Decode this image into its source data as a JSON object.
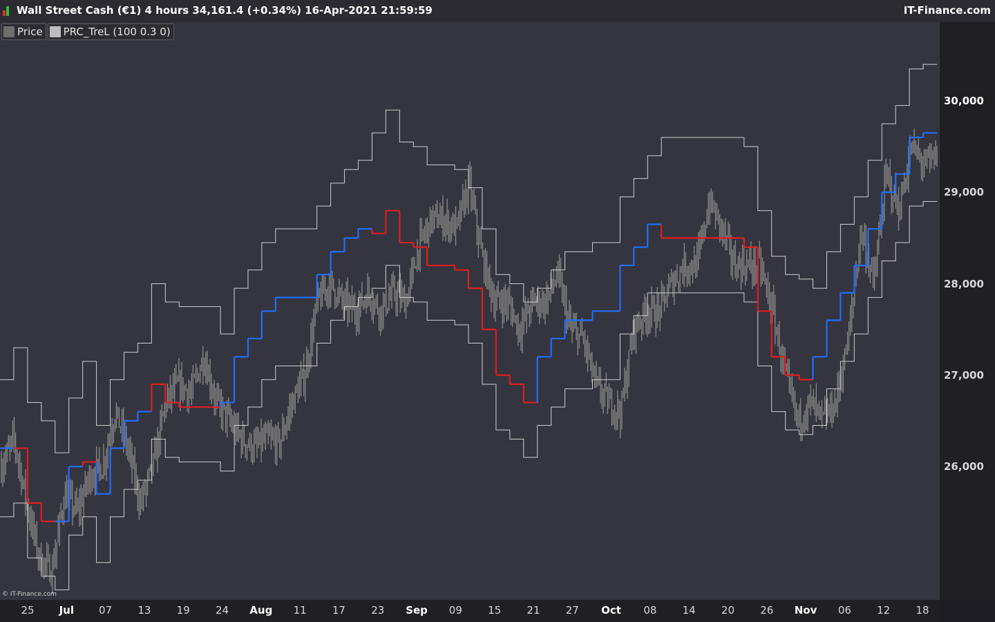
{
  "header": {
    "title": "Wall Street Cash (€1) 4 hours 34,161.4 (+0.34%) 16-Apr-2021 21:59:59",
    "brand": "IT-Finance.com"
  },
  "legend": {
    "items": [
      {
        "label": "Price",
        "color": "#6e6e6e"
      },
      {
        "label": "PRC_TreL (100 0.3 0)",
        "color": "#bdbdbd"
      }
    ]
  },
  "copyright": "© IT-Finance.com",
  "colors": {
    "price": "#8a8a8a",
    "band": "#d0d0d0",
    "uptrend": "#1f6fff",
    "downtrend": "#e01e1e"
  },
  "chart_data": {
    "type": "line",
    "ylim": [
      24500,
      31000
    ],
    "y_ticks": [
      {
        "value": 30000,
        "label": "30,000"
      },
      {
        "value": 29000,
        "label": "29,000"
      },
      {
        "value": 28000,
        "label": "28,000"
      },
      {
        "value": 27000,
        "label": "27,000"
      },
      {
        "value": 26000,
        "label": "26,000"
      }
    ],
    "x_ticks": [
      {
        "label": "25",
        "month": false
      },
      {
        "label": "Jul",
        "month": true
      },
      {
        "label": "07",
        "month": false
      },
      {
        "label": "13",
        "month": false
      },
      {
        "label": "19",
        "month": false
      },
      {
        "label": "24",
        "month": false
      },
      {
        "label": "Aug",
        "month": true
      },
      {
        "label": "11",
        "month": false
      },
      {
        "label": "17",
        "month": false
      },
      {
        "label": "23",
        "month": false
      },
      {
        "label": "Sep",
        "month": true
      },
      {
        "label": "09",
        "month": false
      },
      {
        "label": "15",
        "month": false
      },
      {
        "label": "21",
        "month": false
      },
      {
        "label": "27",
        "month": false
      },
      {
        "label": "Oct",
        "month": true
      },
      {
        "label": "08",
        "month": false
      },
      {
        "label": "14",
        "month": false
      },
      {
        "label": "20",
        "month": false
      },
      {
        "label": "26",
        "month": false
      },
      {
        "label": "Nov",
        "month": true
      },
      {
        "label": "06",
        "month": false
      },
      {
        "label": "12",
        "month": false
      },
      {
        "label": "18",
        "month": false
      }
    ],
    "price_path": [
      26000,
      26300,
      25600,
      25000,
      24850,
      25700,
      25500,
      25900,
      26000,
      26600,
      26200,
      25600,
      26000,
      26700,
      26900,
      26800,
      27200,
      26700,
      26500,
      26300,
      26200,
      26300,
      26250,
      26700,
      27000,
      27800,
      28000,
      27800,
      27700,
      27900,
      27700,
      27900,
      27800,
      28400,
      28700,
      28700,
      28600,
      29100,
      28300,
      27800,
      27800,
      27500,
      27800,
      27800,
      28100,
      27500,
      27400,
      26900,
      26700,
      26600,
      27500,
      27700,
      27700,
      28000,
      28200,
      28200,
      28900,
      28600,
      28200,
      28200,
      28200,
      27700,
      27000,
      26500,
      26700,
      26500,
      26700,
      27400,
      28600,
      28000,
      29200,
      28800,
      29500,
      29300,
      29400
    ],
    "trend_level": [
      26200,
      26200,
      25600,
      25400,
      25400,
      26000,
      26050,
      25700,
      26200,
      26500,
      26600,
      26900,
      26700,
      26650,
      26650,
      26650,
      26700,
      27200,
      27400,
      27700,
      27850,
      27850,
      27850,
      28100,
      28350,
      28500,
      28600,
      28550,
      28800,
      28450,
      28400,
      28200,
      28200,
      28150,
      27950,
      27500,
      27000,
      26900,
      26700,
      27200,
      27400,
      27600,
      27600,
      27700,
      27700,
      28200,
      28400,
      28650,
      28500,
      28500,
      28500,
      28500,
      28500,
      28500,
      28400,
      27700,
      27200,
      27000,
      26950,
      27200,
      27600,
      27900,
      28200,
      28600,
      29000,
      29200,
      29600,
      29650
    ],
    "trend_state": [
      "up",
      "down",
      "down",
      "down",
      "up",
      "up",
      "down",
      "up",
      "up",
      "up",
      "up",
      "down",
      "down",
      "down",
      "down",
      "down",
      "up",
      "up",
      "up",
      "up",
      "up",
      "up",
      "up",
      "up",
      "up",
      "up",
      "up",
      "down",
      "down",
      "down",
      "down",
      "down",
      "down",
      "down",
      "down",
      "down",
      "down",
      "down",
      "down",
      "up",
      "up",
      "up",
      "up",
      "up",
      "up",
      "up",
      "up",
      "up",
      "down",
      "down",
      "down",
      "down",
      "down",
      "down",
      "down",
      "down",
      "down",
      "down",
      "down",
      "up",
      "up",
      "up",
      "up",
      "up",
      "up",
      "up",
      "up",
      "up"
    ],
    "band_width": 1200
  }
}
